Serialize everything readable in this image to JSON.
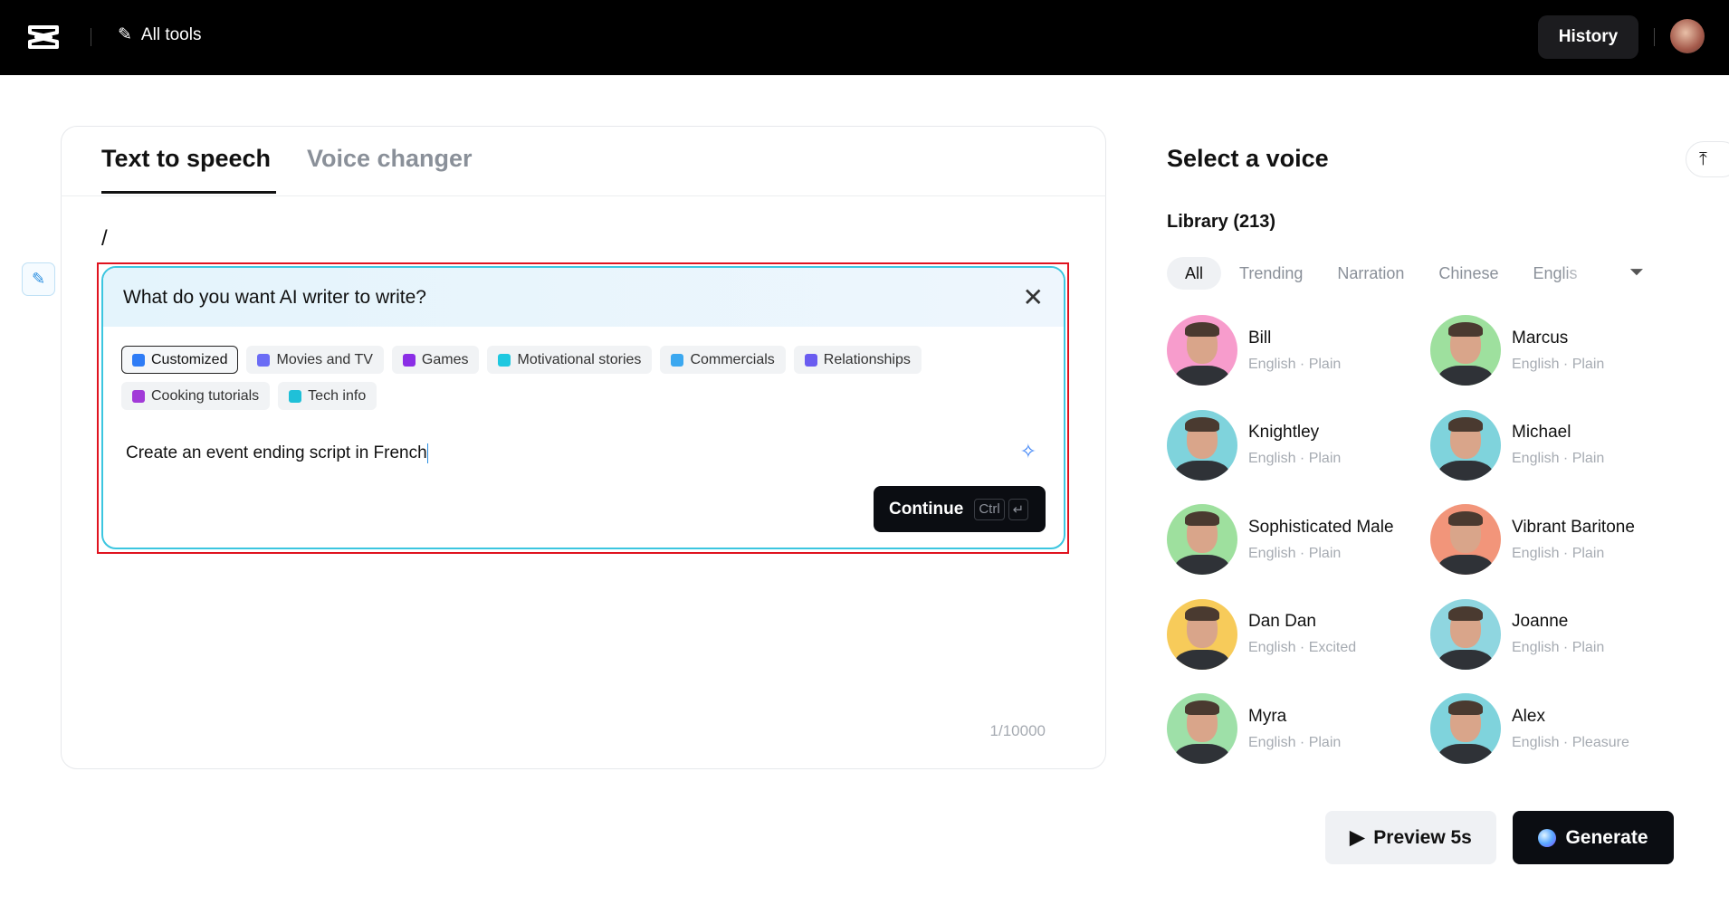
{
  "topbar": {
    "all_tools": "All tools",
    "history": "History"
  },
  "editor": {
    "tabs": [
      "Text to speech",
      "Voice changer"
    ],
    "active_tab": "Text to speech",
    "content": "/",
    "counter": "1/10000"
  },
  "ai_writer": {
    "title": "What do you want AI writer to write?",
    "chips": [
      {
        "label": "Customized",
        "selected": true,
        "color": "#2e7cf6"
      },
      {
        "label": "Movies and TV",
        "color": "#6b6cf5"
      },
      {
        "label": "Games",
        "color": "#8b2ee6"
      },
      {
        "label": "Motivational stories",
        "color": "#1ec8e0"
      },
      {
        "label": "Commercials",
        "color": "#3ba8f0"
      },
      {
        "label": "Relationships",
        "color": "#6a5cf0"
      },
      {
        "label": "Cooking tutorials",
        "color": "#a23ad8"
      },
      {
        "label": "Tech info",
        "color": "#1fc0d8"
      }
    ],
    "prompt": "Create an event ending script in French",
    "continue": "Continue",
    "shortcut": "Ctrl",
    "enter_key": "↵"
  },
  "voices_panel": {
    "title": "Select a voice",
    "library": "Library (213)",
    "filters": [
      "All",
      "Trending",
      "Narration",
      "Chinese",
      "Englis"
    ],
    "voices": [
      {
        "name": "Bill",
        "meta": "English · Plain",
        "bg": "#f79ccc"
      },
      {
        "name": "Marcus",
        "meta": "English · Plain",
        "bg": "#9ee09e"
      },
      {
        "name": "Knightley",
        "meta": "English · Plain",
        "bg": "#7fd3dc"
      },
      {
        "name": "Michael",
        "meta": "English · Plain",
        "bg": "#7fd3dc"
      },
      {
        "name": "Sophisticated Male",
        "meta": "English · Plain",
        "bg": "#9ee09e"
      },
      {
        "name": "Vibrant Baritone",
        "meta": "English · Plain",
        "bg": "#f2957a"
      },
      {
        "name": "Dan Dan",
        "meta": "English · Excited",
        "bg": "#f7cb5a"
      },
      {
        "name": "Joanne",
        "meta": "English · Plain",
        "bg": "#8fd6e0"
      },
      {
        "name": "Myra",
        "meta": "English · Plain",
        "bg": "#9ee0a8"
      },
      {
        "name": "Alex",
        "meta": "English · Pleasure",
        "bg": "#7fd3dc"
      }
    ]
  },
  "actions": {
    "preview": "Preview 5s",
    "generate": "Generate"
  }
}
